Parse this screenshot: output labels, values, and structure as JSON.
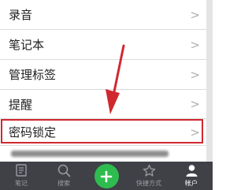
{
  "settings": {
    "items": [
      {
        "label": "录音",
        "chevron": ">"
      },
      {
        "label": "笔记本",
        "chevron": ">"
      },
      {
        "label": "管理标签",
        "chevron": ">"
      },
      {
        "label": "提醒",
        "chevron": ">"
      },
      {
        "label": "密码锁定",
        "chevron": ">"
      }
    ]
  },
  "annotation": {
    "highlight_color": "#d0282f",
    "arrow_color": "#d0282f"
  },
  "tabbar": {
    "background": "#3f4147",
    "tabs": [
      {
        "label": "笔记",
        "icon": "note-icon"
      },
      {
        "label": "搜索",
        "icon": "search-icon"
      },
      {
        "label": "",
        "icon": "plus-icon"
      },
      {
        "label": "快捷方式",
        "icon": "star-icon"
      },
      {
        "label": "帐户",
        "icon": "account-icon",
        "active": true
      }
    ]
  }
}
